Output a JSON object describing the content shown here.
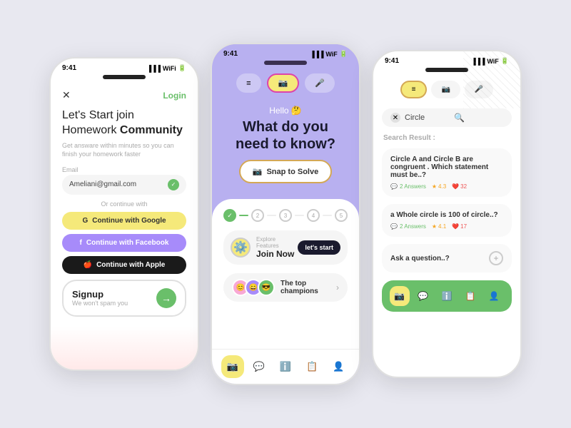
{
  "background": "#e8e8f0",
  "phones": {
    "left": {
      "status_time": "9:41",
      "close_label": "✕",
      "login_label": "Login",
      "headline": "Let's Start join Homework ",
      "headline_bold": "Community",
      "subtext": "Get answare within minutes so you can finish your homework faster",
      "email_label": "Email",
      "email_value": "Ameliani@gmail.com",
      "or_text": "Or continue with",
      "google_btn": "Continue with Google",
      "facebook_btn": "Continue with Facebook",
      "apple_btn": "Continue with Apple",
      "signup_title": "Signup",
      "signup_sub": "We won't spam you"
    },
    "middle": {
      "status_time": "9:41",
      "hello_text": "Hello 🤔",
      "main_question": "What do you need to know?",
      "snap_btn": "Snap to Solve",
      "progress_steps": [
        "2",
        "3",
        "4",
        "5"
      ],
      "explore_label": "Explore Features",
      "join_now_label": "Join Now",
      "lets_start_label": "let's start",
      "champions_label": "The top champions",
      "nav_items": [
        "📷",
        "💬",
        "ℹ️",
        "📋",
        "👤"
      ]
    },
    "right": {
      "status_time": "9:41",
      "search_value": "Circle",
      "search_result_label": "Search Result :",
      "result1_text": "Circle A and Circle B are congruent . Which statement must be..?",
      "result1_answers": "2 Answers",
      "result1_rating": "4.3",
      "result1_likes": "32",
      "result2_text": "a Whole circle is 100 of circle..?",
      "result2_answers": "2 Answers",
      "result2_rating": "4.1",
      "result2_likes": "17",
      "ask_label": "Ask a question..?",
      "nav_items": [
        "📷",
        "💬",
        "ℹ️",
        "📋",
        "👤"
      ]
    }
  }
}
